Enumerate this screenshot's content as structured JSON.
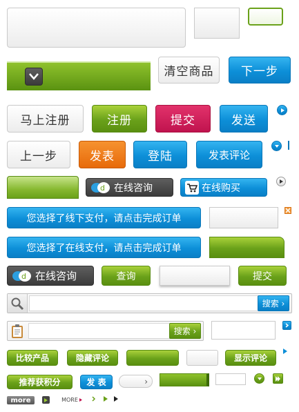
{
  "colors": {
    "green": "#6aa11a",
    "blue": "#0d8fd8",
    "pink": "#c0134e",
    "orange": "#e76a0a",
    "dark": "#3b3b3b"
  },
  "row2": {
    "clear_cart": "清空商品",
    "next_step": "下一步"
  },
  "row3": {
    "quick_register": "马上注册",
    "register": "注册",
    "submit": "提交",
    "send": "发送"
  },
  "row4": {
    "prev_step": "上一步",
    "publish": "发表",
    "login": "登陆",
    "post_comment": "发表评论"
  },
  "row5": {
    "online_consult": "在线咨询",
    "online_buy": "在线购买"
  },
  "row6": {
    "offline_pay": "您选择了线下支付，请点击完成订单"
  },
  "row7": {
    "online_pay": "您选择了在线支付，请点击完成订单"
  },
  "row8": {
    "online_consult": "在线咨询",
    "query": "查询",
    "submit": "提交"
  },
  "search1": {
    "button": "搜索 ›"
  },
  "search2": {
    "button": "搜索 ›"
  },
  "row11": {
    "compare": "比较产品",
    "hide_comments": "隐藏评论",
    "show_comments": "显示评论"
  },
  "row12": {
    "recommend_points": "推荐获积分",
    "publish": "发 表",
    "arrow": "›"
  },
  "row13": {
    "more_dark": "more",
    "more_small": "MORE"
  },
  "icons": {
    "chevron": "chevron-down-icon",
    "play": "play-icon",
    "cart": "cart-icon",
    "chat": "chat-icon",
    "search": "search-icon",
    "clipboard": "clipboard-icon",
    "close": "close-icon"
  }
}
